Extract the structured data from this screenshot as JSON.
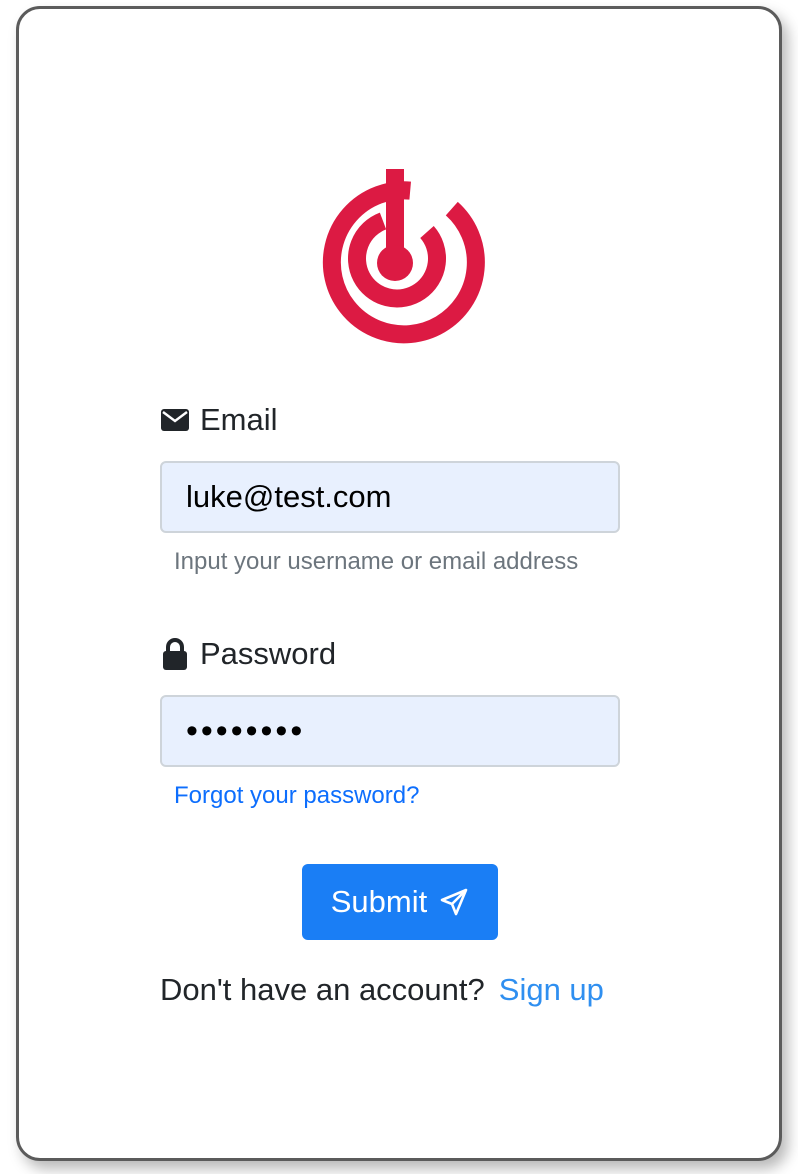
{
  "brand": {
    "logo_icon": "target-radar-logo-icon",
    "logo_color": "#dc1a43"
  },
  "email": {
    "icon": "envelope-icon",
    "label": "Email",
    "value": "luke@test.com",
    "helper": "Input your username or email address"
  },
  "password": {
    "icon": "lock-icon",
    "label": "Password",
    "value": "••••••••",
    "forgot_link": "Forgot your password?"
  },
  "submit": {
    "label": "Submit",
    "icon": "send-icon",
    "color": "#1a7ef5"
  },
  "signup": {
    "prompt": "Don't have an account?",
    "link": "Sign up"
  }
}
